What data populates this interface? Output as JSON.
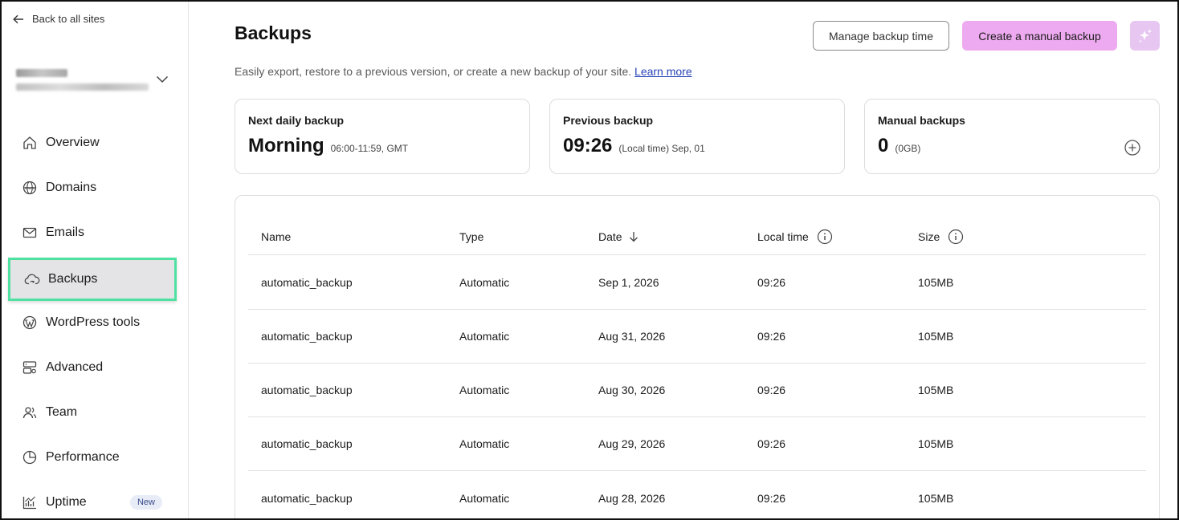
{
  "sidebar": {
    "back_label": "Back to all sites",
    "items": [
      {
        "label": "Overview",
        "icon": "home-icon"
      },
      {
        "label": "Domains",
        "icon": "globe-icon"
      },
      {
        "label": "Emails",
        "icon": "mail-icon"
      },
      {
        "label": "Backups",
        "icon": "cloud-icon",
        "active": true
      },
      {
        "label": "WordPress tools",
        "icon": "wordpress-icon"
      },
      {
        "label": "Advanced",
        "icon": "server-icon"
      },
      {
        "label": "Team",
        "icon": "team-icon"
      },
      {
        "label": "Performance",
        "icon": "clock-icon"
      },
      {
        "label": "Uptime",
        "icon": "chart-icon",
        "badge": "New"
      }
    ]
  },
  "header": {
    "title": "Backups",
    "subtitle": "Easily export, restore to a previous version, or create a new backup of your site.",
    "learn_more": "Learn more",
    "manage_label": "Manage backup time",
    "create_label": "Create a manual backup"
  },
  "cards": {
    "next": {
      "label": "Next daily backup",
      "value": "Morning",
      "detail": "06:00-11:59, GMT"
    },
    "previous": {
      "label": "Previous backup",
      "value": "09:26",
      "detail": "(Local time) Sep, 01"
    },
    "manual": {
      "label": "Manual backups",
      "value": "0",
      "detail": "(0GB)"
    }
  },
  "table": {
    "columns": [
      "Name",
      "Type",
      "Date",
      "Local time",
      "Size"
    ],
    "rows": [
      {
        "name": "automatic_backup",
        "type": "Automatic",
        "date": "Sep 1, 2026",
        "time": "09:26",
        "size": "105MB"
      },
      {
        "name": "automatic_backup",
        "type": "Automatic",
        "date": "Aug 31, 2026",
        "time": "09:26",
        "size": "105MB"
      },
      {
        "name": "automatic_backup",
        "type": "Automatic",
        "date": "Aug 30, 2026",
        "time": "09:26",
        "size": "105MB"
      },
      {
        "name": "automatic_backup",
        "type": "Automatic",
        "date": "Aug 29, 2026",
        "time": "09:26",
        "size": "105MB"
      },
      {
        "name": "automatic_backup",
        "type": "Automatic",
        "date": "Aug 28, 2026",
        "time": "09:26",
        "size": "105MB"
      }
    ]
  },
  "colors": {
    "primary_button": "#eeaaf0",
    "active_outline": "#4fe1a2",
    "link": "#2745b6"
  }
}
